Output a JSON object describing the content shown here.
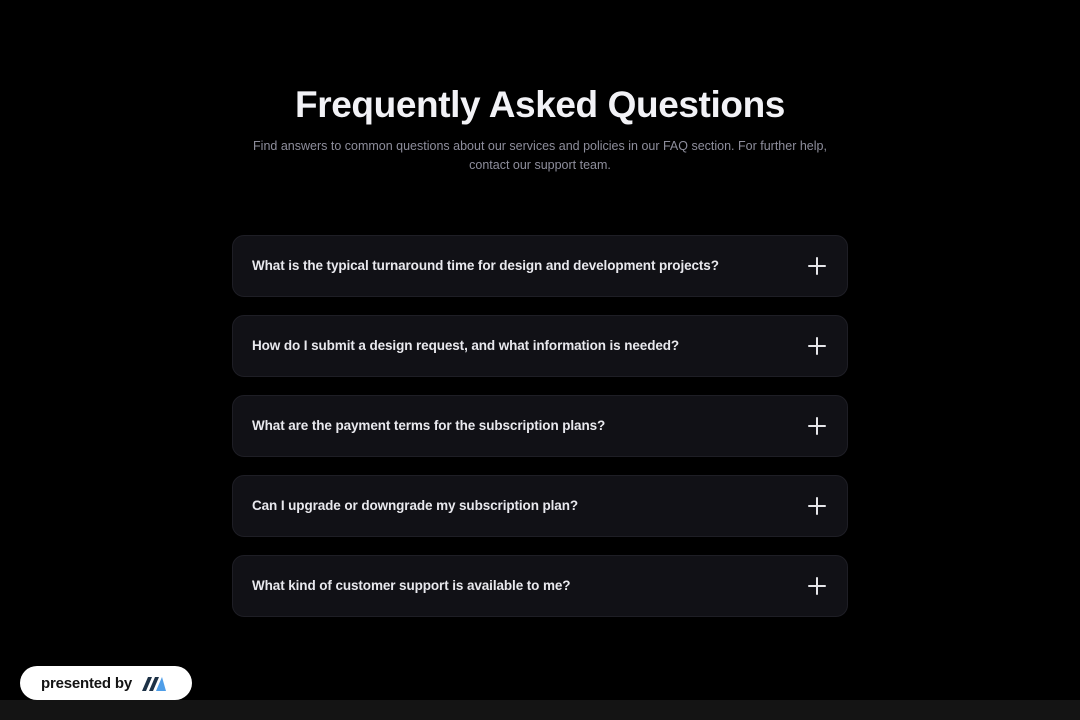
{
  "header": {
    "title": "Frequently Asked Questions",
    "subtitle": "Find answers to common questions about our services and policies in our FAQ section. For further help, contact our support team."
  },
  "faq": {
    "items": [
      {
        "question": "What is the typical turnaround time for design and development projects?",
        "icon": "plus-icon",
        "expanded": false
      },
      {
        "question": "How do I submit a design request, and what information is needed?",
        "icon": "plus-icon",
        "expanded": false
      },
      {
        "question": "What are the payment terms for the subscription plans?",
        "icon": "plus-icon",
        "expanded": false
      },
      {
        "question": "Can I upgrade or downgrade my subscription plan?",
        "icon": "plus-icon",
        "expanded": false
      },
      {
        "question": "What kind of customer support is available to me?",
        "icon": "plus-icon",
        "expanded": false
      }
    ]
  },
  "badge": {
    "label": "presented by",
    "logo_icon": "brand-logo-icon"
  },
  "colors": {
    "background": "#000000",
    "card": "#111116",
    "title": "#f2f2f6",
    "subtitle": "#8e8e9c",
    "logo_dark": "#1d3146",
    "logo_light": "#4f9ee8"
  }
}
